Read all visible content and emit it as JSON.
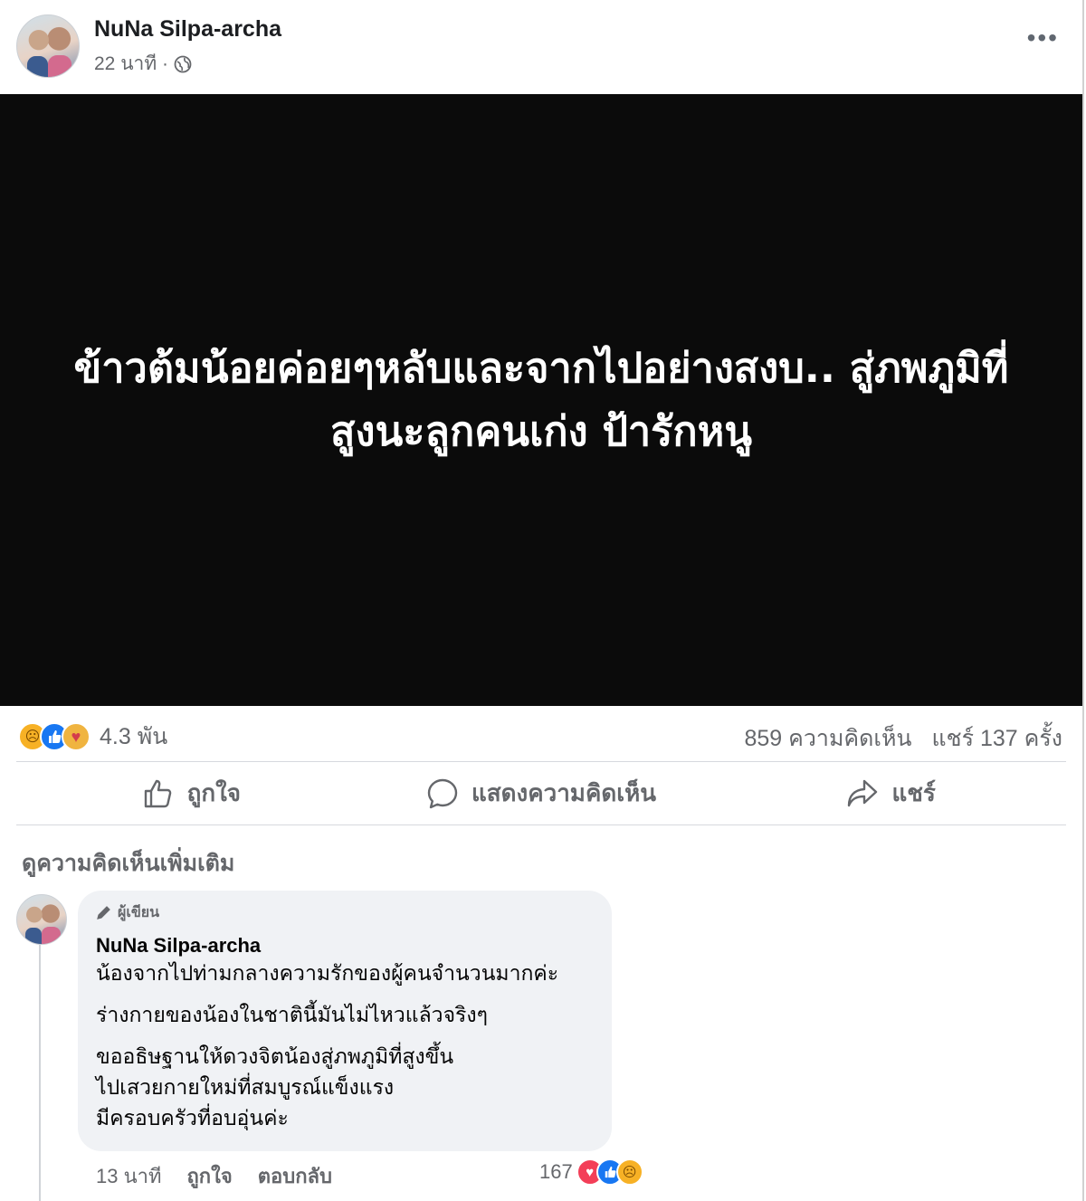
{
  "post": {
    "author": "NuNa Silpa-archa",
    "time": "22 นาที ·",
    "privacy_icon": "globe-icon",
    "more_icon": "more-options-icon",
    "image_text": "ข้าวต้มน้อยค่อยๆหลับและจากไปอย่างสงบ.. สู่ภพภูมิที่สูงนะลูกคนเก่ง ป้ารักหนู"
  },
  "stats": {
    "reactions": [
      "sad",
      "like",
      "care"
    ],
    "reaction_count": "4.3 พัน",
    "comments": "859 ความคิดเห็น",
    "shares": "แชร์ 137 ครั้ง"
  },
  "actions": {
    "like": "ถูกใจ",
    "comment": "แสดงความคิดเห็น",
    "share": "แชร์"
  },
  "comments_section": {
    "more_label": "ดูความคิดเห็นเพิ่มเติม",
    "comment": {
      "badge": "ผู้เขียน",
      "author": "NuNa Silpa-archa",
      "lines": [
        "น้องจากไปท่ามกลางความรักของผู้คนจำนวนมากค่ะ",
        "ร่างกายของน้องในชาตินี้มันไม่ไหวแล้วจริงๆ",
        "ขออธิษฐานให้ดวงจิตน้องสู่ภพภูมิที่สูงขึ้น",
        "ไปเสวยกายใหม่ที่สมบูรณ์แข็งแรง",
        "มีครอบครัวที่อบอุ่นค่ะ"
      ],
      "time": "13 นาที",
      "like": "ถูกใจ",
      "reply": "ตอบกลับ",
      "reaction_count": "167",
      "reactions": [
        "love",
        "like",
        "sad"
      ]
    }
  },
  "colors": {
    "like_blue": "#1877f2",
    "secondary_text": "#65676b",
    "bubble_bg": "#f0f2f5",
    "image_bg": "#0b0b0b"
  }
}
